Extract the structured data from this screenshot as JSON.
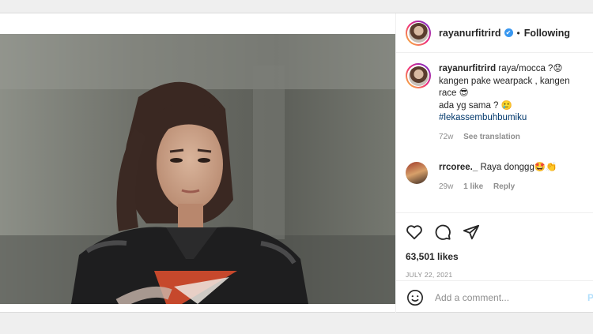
{
  "header": {
    "username": "rayanurfitrird",
    "verified_mark": "✔",
    "separator": "•",
    "follow_status": "Following"
  },
  "caption": {
    "username": "rayanurfitrird",
    "line1": "raya/mocca ?😟",
    "line2": "kangen pake wearpack , kangen race 😎",
    "line3": "ada yg sama ? 🥲",
    "hashtag": "#lekassembuhbumiku",
    "age": "72w",
    "translation": "See translation"
  },
  "comment": {
    "username": "rrcoree._",
    "text": "Raya donggg🤩👏",
    "age": "29w",
    "likes": "1 like",
    "reply": "Reply"
  },
  "actions": {
    "icons": [
      "heart-icon",
      "comment-icon",
      "share-icon"
    ],
    "likes": "63,501 likes",
    "date": "JULY 22, 2021"
  },
  "composer": {
    "placeholder": "Add a comment...",
    "post": "P"
  },
  "colors": {
    "link": "#00376b",
    "verified": "#3897f0",
    "muted": "#8e8e8e",
    "jacket_accent": "#e4502f"
  }
}
